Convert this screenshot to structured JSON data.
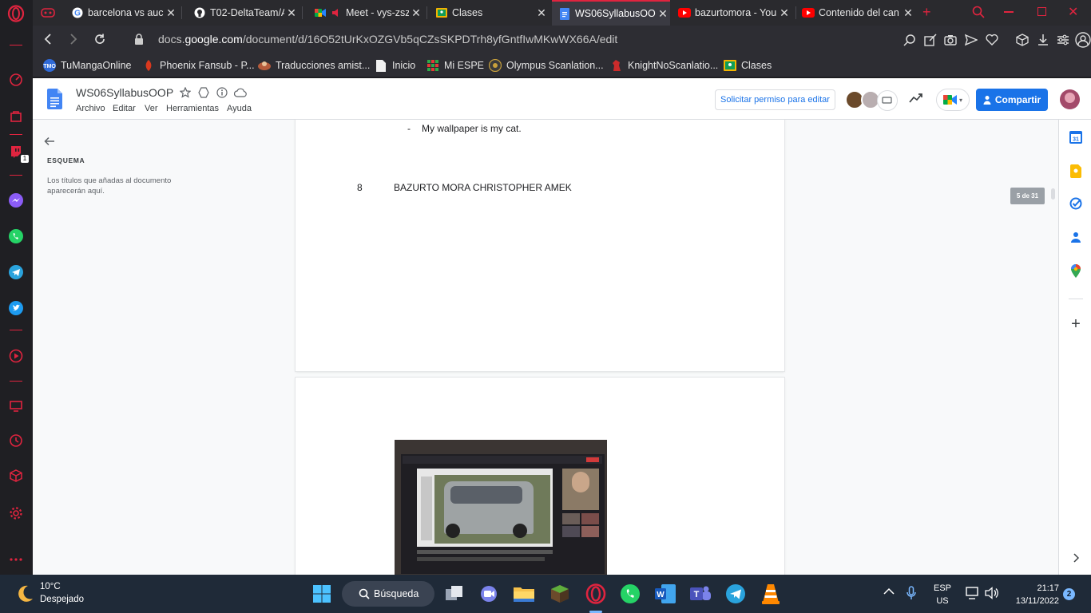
{
  "browser": {
    "tabs": [
      {
        "title": "barcelona vs aucas",
        "icon": "google-icon"
      },
      {
        "title": "T02-DeltaTeam/Ap",
        "icon": "github-icon"
      },
      {
        "title": "Meet - vys-zszl",
        "icon": "meet-icon"
      },
      {
        "title": "Clases",
        "icon": "classroom-icon"
      },
      {
        "title": "WS06SyllabusOOP",
        "icon": "docs-icon",
        "active": true
      },
      {
        "title": "bazurtomora - You",
        "icon": "youtube-icon"
      },
      {
        "title": "Contenido del can",
        "icon": "youtube-icon"
      }
    ],
    "url_prefix": "docs.",
    "url_domain": "google.com",
    "url_path": "/document/d/16O52tUrKxOZGVb5qCZsSKPDTrh8yfGntfIwMKwWX66A/edit",
    "bookmarks": [
      {
        "label": "TuMangaOnline",
        "icon": "tmo-icon"
      },
      {
        "label": "Phoenix Fansub - P...",
        "icon": "phoenix-icon"
      },
      {
        "label": "Traducciones amist...",
        "icon": "traducciones-icon"
      },
      {
        "label": "Inicio",
        "icon": "page-icon"
      },
      {
        "label": "Mi ESPE",
        "icon": "espe-icon"
      },
      {
        "label": "Olympus Scanlation...",
        "icon": "olympus-icon"
      },
      {
        "label": "KnightNoScanlatio...",
        "icon": "knight-icon"
      },
      {
        "label": "Clases",
        "icon": "classroom-icon"
      }
    ],
    "sidebar_badge": "1"
  },
  "docs": {
    "title": "WS06SyllabusOOP",
    "menu": [
      "Archivo",
      "Editar",
      "Ver",
      "Herramientas",
      "Ayuda"
    ],
    "request_edit": "Solicitar permiso para editar",
    "share": "Compartir",
    "outline_title": "ESQUEMA",
    "outline_note": "Los títulos que añadas al documento aparecerán aquí.",
    "page_indicator": "5 de 31",
    "content": {
      "bullet_dash": "-",
      "bullet_text": "My wallpaper is my cat.",
      "item_number": "8",
      "item_name": "BAZURTO MORA CHRISTOPHER AMEK"
    },
    "accent_color": "#1a73e8"
  },
  "taskbar": {
    "weather_temp": "10°C",
    "weather_desc": "Despejado",
    "search": "Búsqueda",
    "lang_1": "ESP",
    "lang_2": "US",
    "time": "21:17",
    "date": "13/11/2022",
    "notifications": "2"
  }
}
